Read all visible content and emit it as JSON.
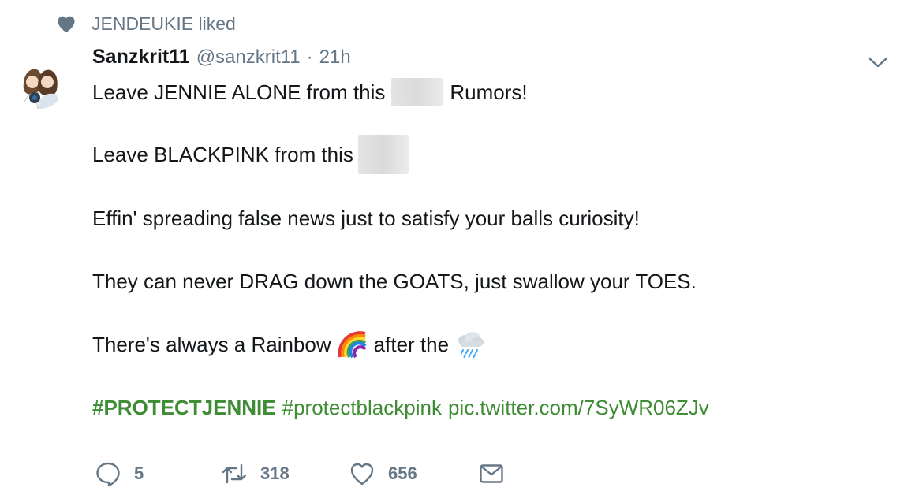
{
  "context": {
    "text": "JENDEUKIE liked",
    "icon": "heart-icon"
  },
  "tweet": {
    "name": "Sanzkrit11",
    "handle": "@sanzkrit11",
    "separator": "·",
    "time": "21h",
    "line1_a": "Leave JENNIE ALONE from this",
    "line1_b": "Rumors!",
    "line2": "Leave BLACKPINK from this",
    "line3": "Effin' spreading false news just to satisfy your balls curiosity!",
    "line4": "They can never DRAG down the GOATS, just swallow your TOES.",
    "line5_a": "There's always a Rainbow",
    "line5_b": "after the",
    "hashtag1": "#PROTECTJENNIE",
    "hashtag2": "#protectblackpink",
    "link": "pic.twitter.com/7SyWR06ZJv"
  },
  "actions": {
    "replies": "5",
    "retweets": "318",
    "likes": "656"
  },
  "colors": {
    "link": "#3e8c33",
    "muted": "#657786",
    "text": "#14171a"
  }
}
